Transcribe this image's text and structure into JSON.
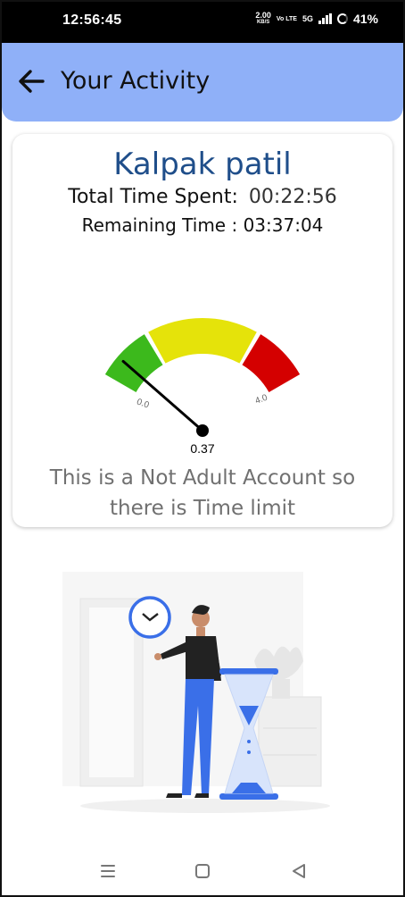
{
  "status_bar": {
    "time": "12:56:45",
    "speed_value": "2.00",
    "speed_unit": "KB/S",
    "volte": "Vo LTE",
    "network": "5G",
    "battery": "41%"
  },
  "app_bar": {
    "title": "Your Activity",
    "back_icon": "arrow-left-icon"
  },
  "card": {
    "user_name": "Kalpak patil",
    "total_time_label": "Total Time Spent:",
    "total_time_value": "00:22:56",
    "remaining_time_text": "Remaining Time : 03:37:04",
    "gauge": {
      "min_label": "0.0",
      "max_label": "4.0",
      "min": 0,
      "max": 4,
      "value": 0.37,
      "value_label": "0.37",
      "segments": [
        {
          "color": "#3cb91c",
          "from": 0,
          "to": 1
        },
        {
          "color": "#e5e30a",
          "from": 1,
          "to": 3
        },
        {
          "color": "#d40000",
          "from": 3,
          "to": 4
        }
      ]
    },
    "notice": "This is a Not Adult Account so there is Time limit"
  },
  "illustration": {
    "icon": "person-with-clock-and-hourglass-illustration",
    "accent": "#3a6fe8"
  },
  "nav_bar": {
    "recents_icon": "menu-lines-icon",
    "home_icon": "square-home-icon",
    "back_icon": "triangle-back-icon"
  }
}
